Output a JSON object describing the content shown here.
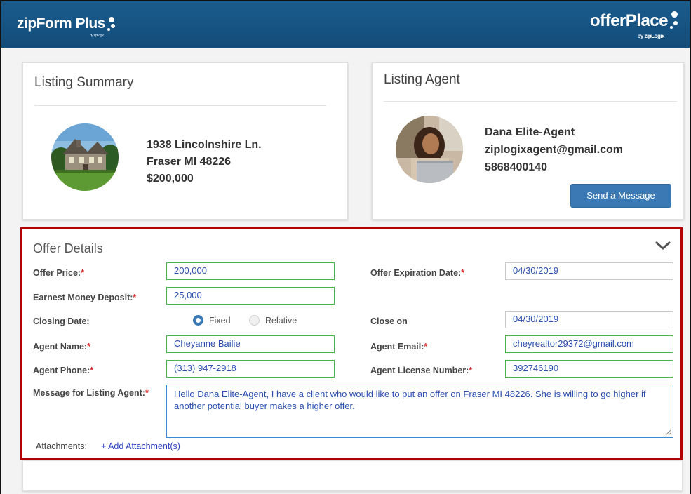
{
  "header": {
    "left_logo": "zipForm Plus",
    "left_logo_sub": "by zipLogix",
    "right_logo": "offerPlace",
    "right_logo_sub": "by zipLogix",
    "bar_color": "#1a5c8e"
  },
  "listing_summary": {
    "title": "Listing Summary",
    "address_line1": "1938 Lincolnshire Ln.",
    "address_line2": "Fraser MI 48226",
    "price": "$200,000",
    "photo_icon": "house-photo"
  },
  "listing_agent": {
    "title": "Listing Agent",
    "name": "Dana Elite-Agent",
    "email": "ziplogixagent@gmail.com",
    "phone": "5868400140",
    "send_button": "Send a Message",
    "photo_icon": "agent-photo"
  },
  "offer": {
    "title": "Offer Details",
    "toggle_icon": "chevron-down-icon",
    "highlight_color": "#b30000",
    "offer_price_label": "Offer Price:",
    "offer_price_value": "200,000",
    "offer_expiration_label": "Offer Expiration Date:",
    "offer_expiration_value": "04/30/2019",
    "earnest_label": "Earnest Money Deposit:",
    "earnest_value": "25,000",
    "closing_label": "Closing Date:",
    "closing_option_fixed": "Fixed",
    "closing_option_relative": "Relative",
    "closing_selected": "Fixed",
    "close_on_label": "Close on",
    "close_on_value": "04/30/2019",
    "agent_name_label": "Agent Name:",
    "agent_name_value": "Cheyanne Bailie",
    "agent_email_label": "Agent Email:",
    "agent_email_value": "cheyrealtor29372@gmail.com",
    "agent_phone_label": "Agent Phone:",
    "agent_phone_value": "(313) 947-2918",
    "agent_license_label": "Agent License Number:",
    "agent_license_value": "392746190",
    "message_label": "Message for Listing Agent:",
    "message_value": "Hello Dana Elite-Agent, I have a client who would like to put an offer on Fraser MI 48226.  She is willing to go higher if another potential buyer makes a higher offer.",
    "attachments_label": "Attachments:",
    "add_attachment": "+ Add Attachment(s)",
    "required_mark": "*"
  }
}
